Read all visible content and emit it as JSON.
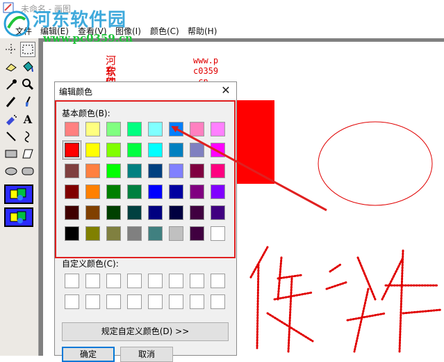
{
  "title_bar": {
    "title": "未命名 - 画图"
  },
  "watermark": {
    "site_name": "河东软件园",
    "url": "www.pc0359.cn"
  },
  "menu": [
    {
      "label": "文件"
    },
    {
      "label": "编辑(E)"
    },
    {
      "label": "查看(V)"
    },
    {
      "label": "图像(I)"
    },
    {
      "label": "颜色(C)"
    },
    {
      "label": "帮助(H)"
    }
  ],
  "toolbox": {
    "tools": [
      "free-select-icon",
      "rect-select-icon",
      "eraser-icon",
      "fill-icon",
      "picker-icon",
      "magnifier-icon",
      "pencil-icon",
      "brush-icon",
      "airbrush-icon",
      "text-icon",
      "line-icon",
      "curve-icon",
      "rectangle-icon",
      "polygon-icon",
      "ellipse-icon",
      "rounded-rect-icon"
    ],
    "selected_tool": "rect-select-icon"
  },
  "canvas": {
    "text_col1": [
      "河东",
      "软件",
      "园"
    ],
    "text_col2": [
      "www.p",
      "c0359",
      ".cn"
    ],
    "handwriting": "软件",
    "accent": "#ff0000"
  },
  "dialog": {
    "title": "编辑颜色",
    "close_glyph": "✕",
    "basic_label": "基本颜色(B):",
    "custom_label": "自定义颜色(C):",
    "define_button": "规定自定义颜色(D) >>",
    "ok_button": "确定",
    "cancel_button": "取消",
    "basic_colors": [
      [
        "#ff8080",
        "#ffff80",
        "#80ff80",
        "#00ff80",
        "#80ffff",
        "#0080ff",
        "#ff80c0",
        "#ff80ff"
      ],
      [
        "#ff0000",
        "#ffff00",
        "#80ff00",
        "#00ff40",
        "#00ffff",
        "#0080c0",
        "#8080c0",
        "#ff00ff"
      ],
      [
        "#804040",
        "#ff8040",
        "#00ff00",
        "#008080",
        "#004080",
        "#8080ff",
        "#800040",
        "#ff0080"
      ],
      [
        "#800000",
        "#ff8000",
        "#008000",
        "#008040",
        "#0000ff",
        "#0000a0",
        "#800080",
        "#8000ff"
      ],
      [
        "#400000",
        "#804000",
        "#004000",
        "#004040",
        "#000080",
        "#000040",
        "#400040",
        "#400080"
      ],
      [
        "#000000",
        "#808000",
        "#808040",
        "#808080",
        "#408080",
        "#c0c0c0",
        "#400040",
        "#ffffff"
      ]
    ],
    "selected_color": "#ff0000",
    "custom_colors": [
      "#ffffff",
      "#ffffff",
      "#ffffff",
      "#ffffff",
      "#ffffff",
      "#ffffff",
      "#ffffff",
      "#ffffff",
      "#ffffff",
      "#ffffff",
      "#ffffff",
      "#ffffff",
      "#ffffff",
      "#ffffff",
      "#ffffff",
      "#ffffff"
    ]
  },
  "annotation": {
    "color": "#e02020"
  }
}
